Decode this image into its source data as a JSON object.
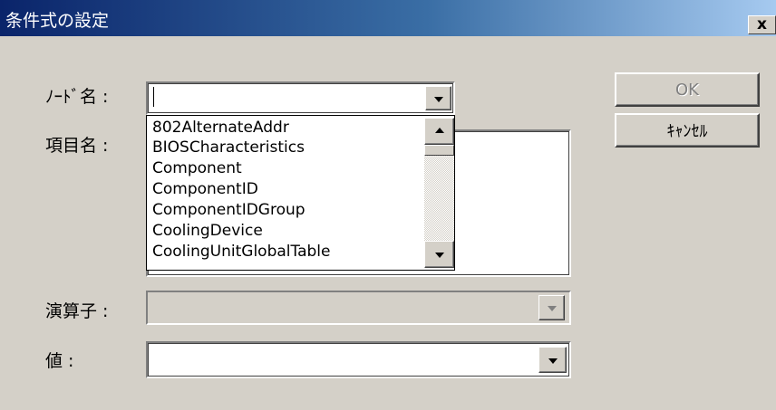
{
  "window": {
    "title": "条件式の設定",
    "close_label": "x"
  },
  "form": {
    "node_label": "ﾉｰﾄﾞ名 :",
    "node_value": "",
    "item_label": "項目名 :",
    "operator_label": "演算子 :",
    "operator_value": "",
    "value_label": "値 :",
    "value_value": ""
  },
  "dropdown": {
    "items": [
      "802AlternateAddr",
      "BIOSCharacteristics",
      "Component",
      "ComponentID",
      "ComponentIDGroup",
      "CoolingDevice",
      "CoolingUnitGlobalTable"
    ]
  },
  "buttons": {
    "ok_label": "OK",
    "cancel_label": "ｷｬﾝｾﾙ"
  },
  "colors": {
    "title_gradient_start": "#0a246a",
    "title_gradient_end": "#a6caf0",
    "dialog_background": "#d4d0c8"
  }
}
